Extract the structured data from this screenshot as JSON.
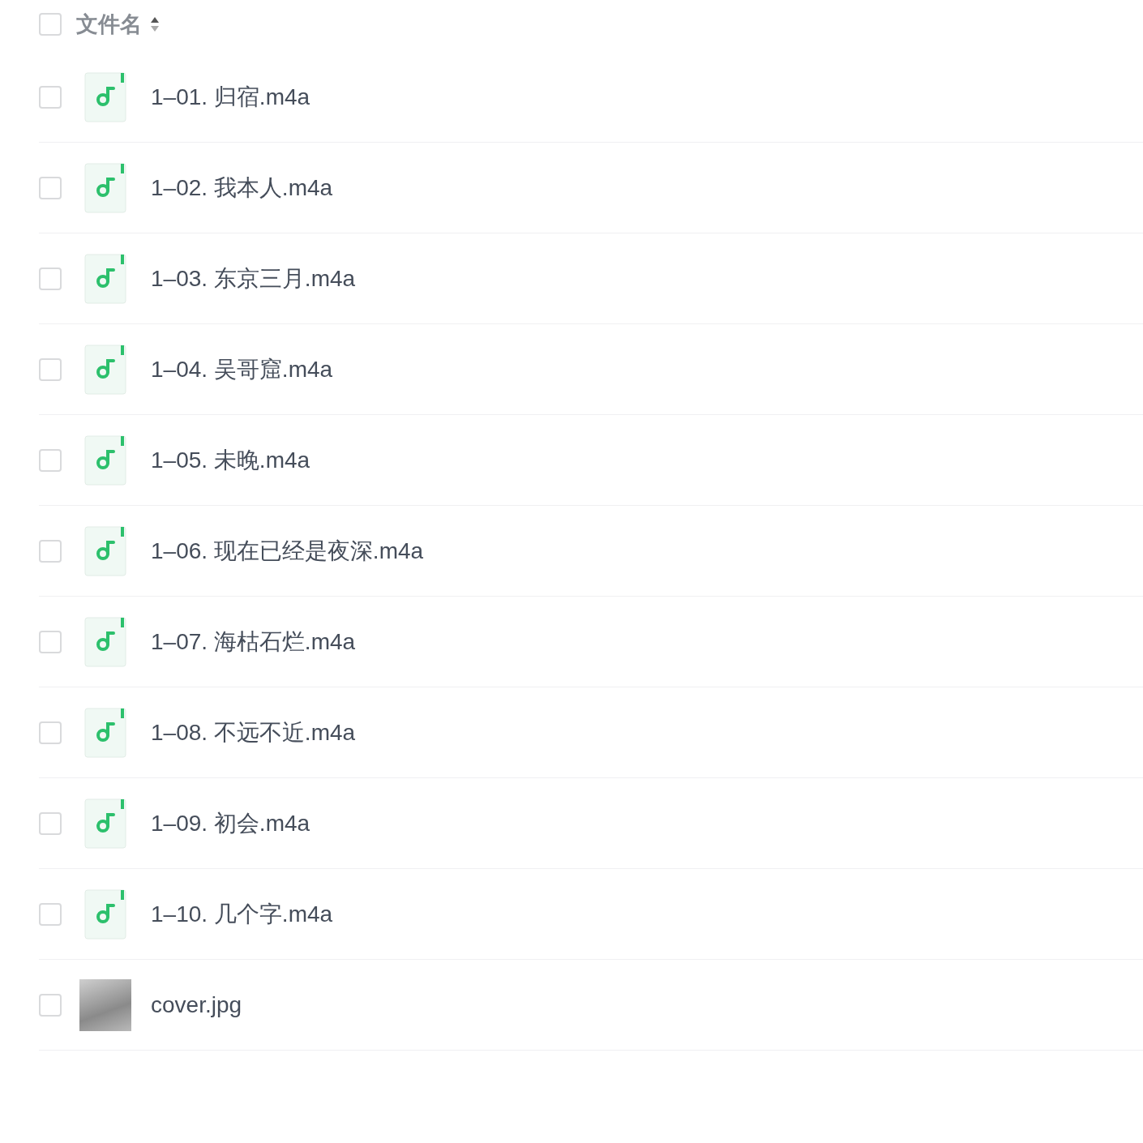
{
  "header": {
    "label": "文件名",
    "checked": false
  },
  "files": [
    {
      "name": "1–01. 归宿.m4a",
      "kind": "audio",
      "checked": false
    },
    {
      "name": "1–02. 我本人.m4a",
      "kind": "audio",
      "checked": false
    },
    {
      "name": "1–03. 东京三月.m4a",
      "kind": "audio",
      "checked": false
    },
    {
      "name": "1–04. 吴哥窟.m4a",
      "kind": "audio",
      "checked": false
    },
    {
      "name": "1–05. 未晚.m4a",
      "kind": "audio",
      "checked": false
    },
    {
      "name": "1–06. 现在已经是夜深.m4a",
      "kind": "audio",
      "checked": false
    },
    {
      "name": "1–07. 海枯石烂.m4a",
      "kind": "audio",
      "checked": false
    },
    {
      "name": "1–08. 不远不近.m4a",
      "kind": "audio",
      "checked": false
    },
    {
      "name": "1–09. 初会.m4a",
      "kind": "audio",
      "checked": false
    },
    {
      "name": "1–10. 几个字.m4a",
      "kind": "audio",
      "checked": false
    },
    {
      "name": "cover.jpg",
      "kind": "image",
      "checked": false
    }
  ]
}
